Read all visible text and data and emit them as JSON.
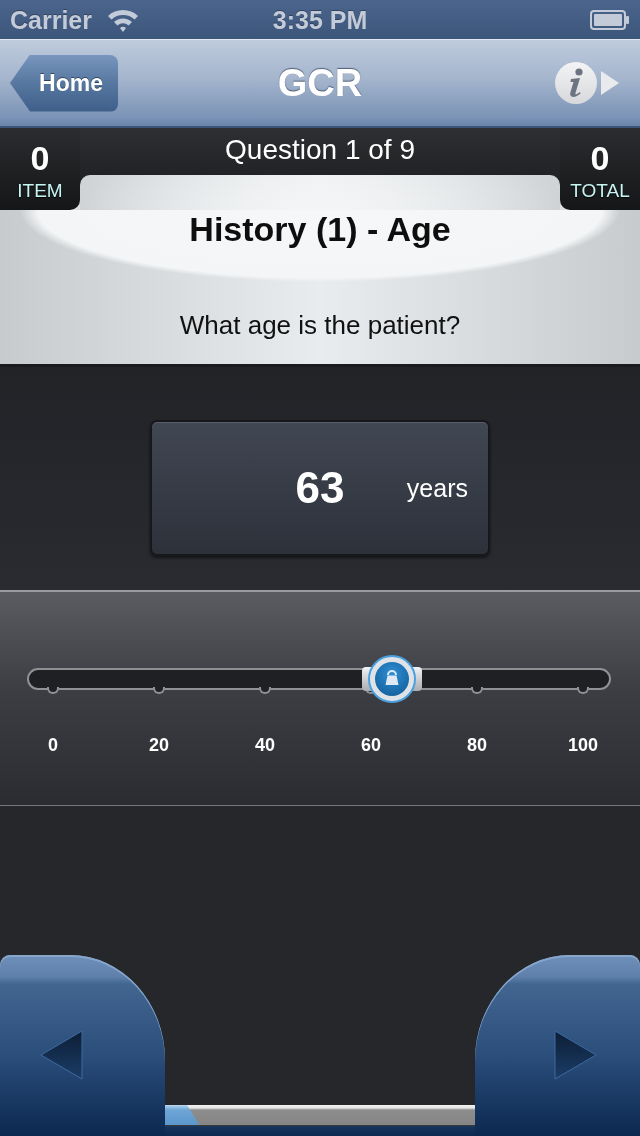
{
  "status_bar": {
    "carrier": "Carrier",
    "time": "3:35 PM"
  },
  "nav_bar": {
    "back_button": "Home",
    "title": "GCR"
  },
  "score_bar": {
    "question_counter": "Question 1 of 9",
    "stats": [
      {
        "value": "0",
        "label": "ITEM"
      },
      {
        "value": "0",
        "label": "TOTAL"
      }
    ]
  },
  "question_card": {
    "title": "History (1) - Age",
    "prompt": "What age is the patient?"
  },
  "answer_display": {
    "value": "63",
    "unit": "years"
  },
  "slider": {
    "level": 0.64,
    "tick_labels": [
      "0",
      "20",
      "40",
      "60",
      "80",
      "100"
    ]
  },
  "footer": {
    "progress": {
      "level": 0.11
    }
  }
}
